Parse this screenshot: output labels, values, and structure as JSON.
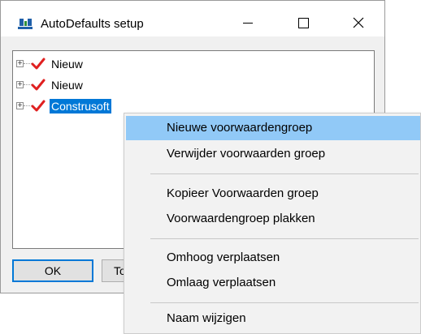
{
  "window": {
    "title": "AutoDefaults setup",
    "minimize_icon": "minimize-icon",
    "maximize_icon": "maximize-icon",
    "close_icon": "close-icon"
  },
  "tree": {
    "items": [
      {
        "label": "Nieuw",
        "icon": "red-check-icon",
        "selected": false
      },
      {
        "label": "Nieuw",
        "icon": "red-check-icon",
        "selected": false
      },
      {
        "label": "Construsoft",
        "icon": "red-check-icon",
        "selected": true
      }
    ]
  },
  "buttons": {
    "ok_label": "OK",
    "second_label": "To"
  },
  "context_menu": {
    "items": [
      {
        "label": "Nieuwe voorwaardengroep",
        "highlighted": true
      },
      {
        "label": "Verwijder voorwaarden groep"
      },
      {
        "label": "Kopieer Voorwaarden groep"
      },
      {
        "label": "Voorwaardengroep plakken"
      },
      {
        "label": "Omhoog verplaatsen"
      },
      {
        "label": "Omlaag verplaatsen"
      },
      {
        "label": "Naam wijzigen"
      }
    ]
  },
  "colors": {
    "selection": "#0078d7",
    "menu_highlight": "#91c9f7",
    "check": "#e02020"
  }
}
